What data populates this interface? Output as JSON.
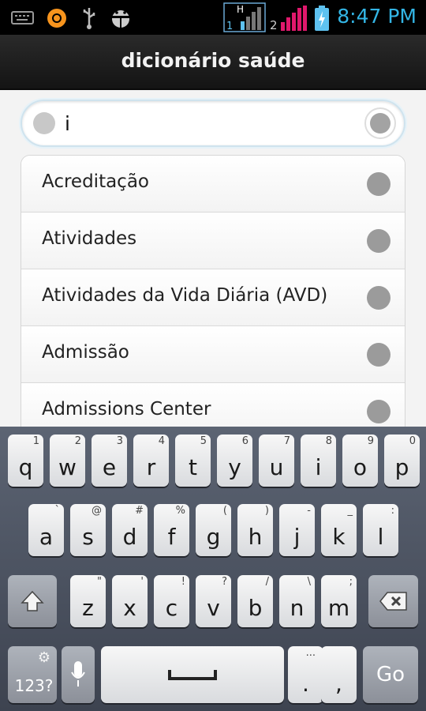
{
  "status_bar": {
    "time": "8:47 PM",
    "icons": [
      "keyboard-icon",
      "orange-app-icon",
      "usb-icon",
      "android-debug-icon",
      "sim1-signal-icon",
      "sim2-signal-icon",
      "battery-charging-icon"
    ],
    "sim1_label": "1",
    "sim1_h_label": "H",
    "sim2_label": "2"
  },
  "app": {
    "title": "dicionário saúde"
  },
  "search": {
    "value": "i"
  },
  "results": [
    {
      "label": "Acreditação"
    },
    {
      "label": "Atividades"
    },
    {
      "label": "Atividades da Vida Diária (AVD)"
    },
    {
      "label": "Admissão"
    },
    {
      "label": "Admissions Center"
    }
  ],
  "keyboard": {
    "row1": [
      {
        "key": "q",
        "sub": "1"
      },
      {
        "key": "w",
        "sub": "2"
      },
      {
        "key": "e",
        "sub": "3"
      },
      {
        "key": "r",
        "sub": "4"
      },
      {
        "key": "t",
        "sub": "5"
      },
      {
        "key": "y",
        "sub": "6"
      },
      {
        "key": "u",
        "sub": "7"
      },
      {
        "key": "i",
        "sub": "8"
      },
      {
        "key": "o",
        "sub": "9"
      },
      {
        "key": "p",
        "sub": "0"
      }
    ],
    "row2": [
      {
        "key": "a",
        "sub": "`"
      },
      {
        "key": "s",
        "sub": "@"
      },
      {
        "key": "d",
        "sub": "#"
      },
      {
        "key": "f",
        "sub": "%"
      },
      {
        "key": "g",
        "sub": "("
      },
      {
        "key": "h",
        "sub": ")"
      },
      {
        "key": "j",
        "sub": "-"
      },
      {
        "key": "k",
        "sub": "_"
      },
      {
        "key": "l",
        "sub": ":"
      }
    ],
    "row3": [
      {
        "key": "z",
        "sub": "\""
      },
      {
        "key": "x",
        "sub": "'"
      },
      {
        "key": "c",
        "sub": "!"
      },
      {
        "key": "v",
        "sub": "?"
      },
      {
        "key": "b",
        "sub": "/"
      },
      {
        "key": "n",
        "sub": "\\"
      },
      {
        "key": "m",
        "sub": ";"
      }
    ],
    "symbols_label": "123?",
    "period_label": ".",
    "period_sub": "...",
    "comma_label": ",",
    "go_label": "Go"
  }
}
